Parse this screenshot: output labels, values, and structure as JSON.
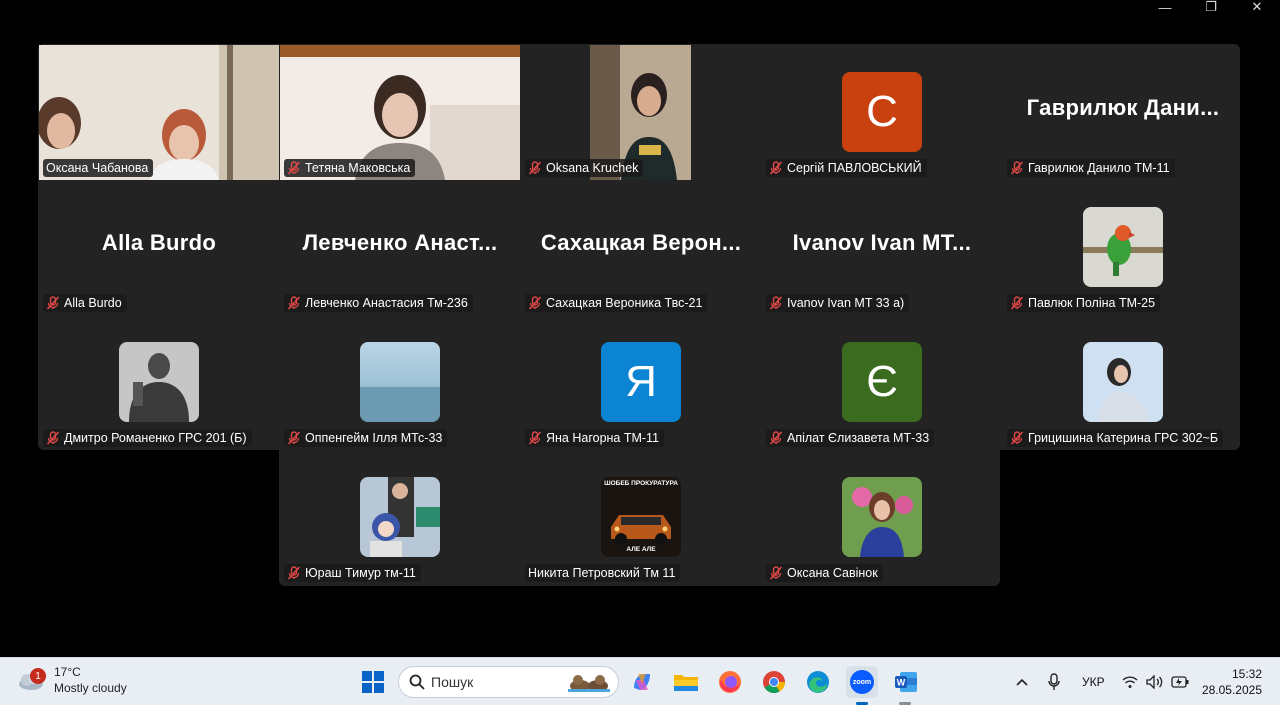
{
  "window_controls": [
    "—",
    "❐",
    "✕"
  ],
  "participants": [
    {
      "name": "Оксана Чабанова",
      "muted": false,
      "kind": "video",
      "active": true
    },
    {
      "name": "Тетяна Маковська",
      "muted": true,
      "kind": "video"
    },
    {
      "name": "Oksana Kruchek",
      "muted": true,
      "kind": "video"
    },
    {
      "name": "Сергій ПАВЛОВСЬКИЙ",
      "muted": true,
      "kind": "letter",
      "letter": "C",
      "color": "#c8410f"
    },
    {
      "name": "Гаврилюк Данило ТМ-11",
      "muted": true,
      "kind": "bigname",
      "display": "Гаврилюк  Дани..."
    },
    {
      "name": "Alla Burdo",
      "muted": true,
      "kind": "bigname",
      "display": "Alla Burdo"
    },
    {
      "name": "Левченко Анастасия Тм-236",
      "muted": true,
      "kind": "bigname",
      "display": "Левченко  Анаст..."
    },
    {
      "name": "Сахацкая Вероника Твс-21",
      "muted": true,
      "kind": "bigname",
      "display": "Сахацкая  Верон..."
    },
    {
      "name": "Ivanov Ivan MT 33 a)",
      "muted": true,
      "kind": "bigname",
      "display": "Ivanov  Ivan  MT..."
    },
    {
      "name": "Павлюк Поліна ТМ-25",
      "muted": true,
      "kind": "photo",
      "photo": "parrot"
    },
    {
      "name": "Дмитро Романенко ГРС 201 (Б)",
      "muted": true,
      "kind": "photo",
      "photo": "man"
    },
    {
      "name": "Оппенгейм Ілля МТс-33",
      "muted": true,
      "kind": "photo",
      "photo": "sea"
    },
    {
      "name": "Яна Нагорна ТМ-11",
      "muted": true,
      "kind": "letter",
      "letter": "Я",
      "color": "#0b84d4"
    },
    {
      "name": "Апілат Єлизавета МТ-33",
      "muted": true,
      "kind": "letter",
      "letter": "Є",
      "color": "#3a6b1e"
    },
    {
      "name": "Грицишина Катерина ГРС 302~Б",
      "muted": true,
      "kind": "photo",
      "photo": "girl"
    },
    {
      "name": "Юраш Тимур тм-11",
      "muted": true,
      "kind": "photo",
      "photo": "anime"
    },
    {
      "name": "Никита Петровский Тм 11",
      "muted": false,
      "kind": "photo",
      "photo": "car"
    },
    {
      "name": "Оксана Савінок",
      "muted": true,
      "kind": "photo",
      "photo": "woman"
    }
  ],
  "car_caption_top": "ШОБЕБ ПРОКУРАТУРА",
  "car_caption_bottom": "АЛЕ АЛЕ",
  "taskbar": {
    "weather_temp": "17°C",
    "weather_desc": "Mostly cloudy",
    "weather_badge": "1",
    "search_placeholder": "Пошук",
    "language": "УКР",
    "time": "15:32",
    "date": "28.05.2025",
    "zoom_label": "zoom"
  }
}
